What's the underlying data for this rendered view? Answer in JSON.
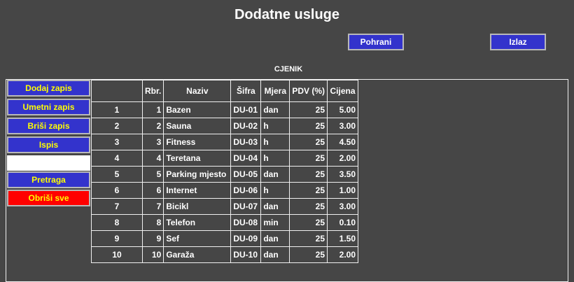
{
  "page": {
    "title": "Dodatne usluge"
  },
  "toolbar": {
    "save_label": "Pohrani",
    "exit_label": "Izlaz"
  },
  "section": {
    "title": "CJENIK"
  },
  "sidebar": {
    "add_label": "Dodaj zapis",
    "insert_label": "Umetni zapis",
    "delete_label": "Briši zapis",
    "print_label": "Ispis",
    "search_value": "",
    "search_label": "Pretraga",
    "clear_label": "Obriši sve"
  },
  "colors": {
    "background": "#464646",
    "button_blue": "#3333cc",
    "button_red": "#ff0000",
    "sidebar_text": "#ffff00"
  },
  "table": {
    "columns": [
      "",
      "Rbr.",
      "Naziv",
      "Šifra",
      "Mjera",
      "PDV (%)",
      "Cijena"
    ],
    "rows": [
      [
        "1",
        "1",
        "Bazen",
        "DU-01",
        "dan",
        "25",
        "5.00"
      ],
      [
        "2",
        "2",
        "Sauna",
        "DU-02",
        "h",
        "25",
        "3.00"
      ],
      [
        "3",
        "3",
        "Fitness",
        "DU-03",
        "h",
        "25",
        "4.50"
      ],
      [
        "4",
        "4",
        "Teretana",
        "DU-04",
        "h",
        "25",
        "2.00"
      ],
      [
        "5",
        "5",
        "Parking mjesto",
        "DU-05",
        "dan",
        "25",
        "3.50"
      ],
      [
        "6",
        "6",
        "Internet",
        "DU-06",
        "h",
        "25",
        "1.00"
      ],
      [
        "7",
        "7",
        "Bicikl",
        "DU-07",
        "dan",
        "25",
        "3.00"
      ],
      [
        "8",
        "8",
        "Telefon",
        "DU-08",
        "min",
        "25",
        "0.10"
      ],
      [
        "9",
        "9",
        "Sef",
        "DU-09",
        "dan",
        "25",
        "1.50"
      ],
      [
        "10",
        "10",
        "Garaža",
        "DU-10",
        "dan",
        "25",
        "2.00"
      ]
    ]
  }
}
